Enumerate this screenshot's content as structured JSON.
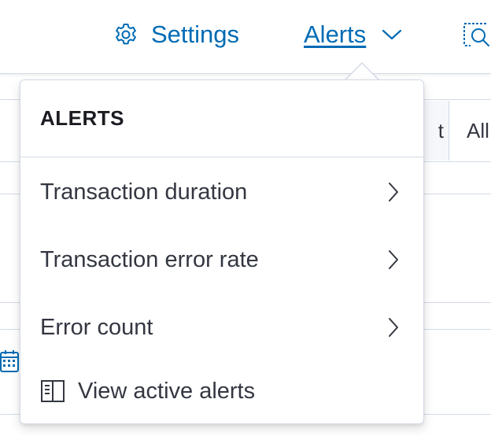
{
  "header": {
    "settings_label": "Settings",
    "alerts_label": "Alerts"
  },
  "background": {
    "button_partial_label": "t",
    "button_all_label": "All"
  },
  "alerts_menu": {
    "title": "ALERTS",
    "items": [
      {
        "label": "Transaction duration",
        "icon": "chevron-right-icon"
      },
      {
        "label": "Transaction error rate",
        "icon": "chevron-right-icon"
      },
      {
        "label": "Error count",
        "icon": "chevron-right-icon"
      },
      {
        "label": "View active alerts",
        "icon": "book-icon"
      }
    ]
  },
  "colors": {
    "link": "#006bb4",
    "text": "#343741",
    "border": "#d3dae6"
  }
}
